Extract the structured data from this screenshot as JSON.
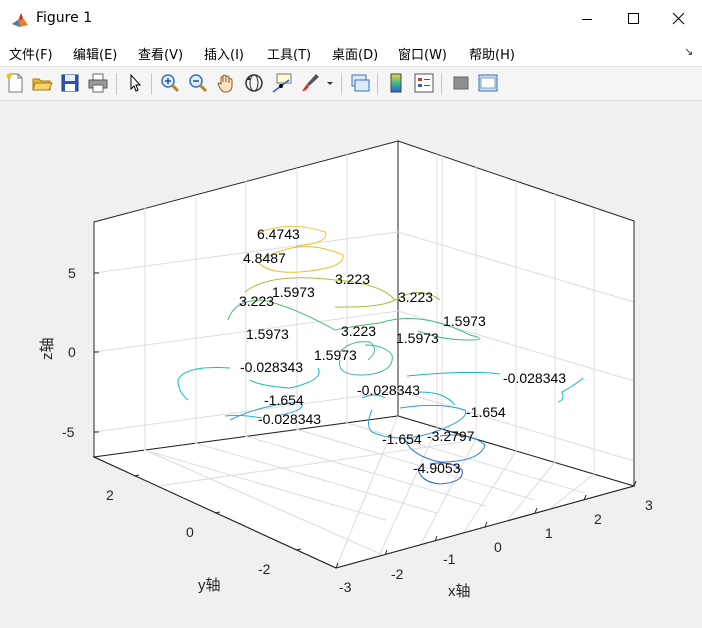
{
  "window": {
    "title": "Figure 1"
  },
  "menu": {
    "items": [
      "文件(F)",
      "编辑(E)",
      "查看(V)",
      "插入(I)",
      "工具(T)",
      "桌面(D)",
      "窗口(W)",
      "帮助(H)"
    ],
    "overflow": "↘"
  },
  "toolbar": {
    "icons": [
      "new-figure-icon",
      "open-file-icon",
      "save-icon",
      "print-icon",
      "pointer-icon",
      "zoom-in-icon",
      "zoom-out-icon",
      "pan-icon",
      "rotate-3d-icon",
      "data-cursor-icon",
      "brush-icon",
      "link-plot-icon",
      "colorbar-icon",
      "legend-icon",
      "hide-plot-tools-icon",
      "show-plot-tools-icon"
    ]
  },
  "axes": {
    "xlabel": "x轴",
    "ylabel": "y轴",
    "zlabel": "z轴",
    "xticks": [
      "-3",
      "-2",
      "-1",
      "0",
      "1",
      "2",
      "3"
    ],
    "yticks": [
      "2",
      "0",
      "-2"
    ],
    "zticks": [
      "5",
      "0",
      "-5"
    ]
  },
  "chart_data": {
    "type": "line",
    "subtype": "3d-contour",
    "title": "",
    "xlabel": "x轴",
    "ylabel": "y轴",
    "zlabel": "z轴",
    "xlim": [
      -3,
      3
    ],
    "ylim": [
      -3,
      3
    ],
    "zlim": [
      -6.5,
      8
    ],
    "grid": true,
    "contour_labels": [
      {
        "text": "6.4743",
        "x": -1.1,
        "y": 1.2,
        "z": 6.47
      },
      {
        "text": "4.8487",
        "x": -1.4,
        "y": 1.3,
        "z": 4.85
      },
      {
        "text": "3.223",
        "x": -0.2,
        "y": 1.6,
        "z": 3.22
      },
      {
        "text": "1.5973",
        "x": -1.0,
        "y": 1.5,
        "z": 1.6
      },
      {
        "text": "3.223",
        "x": 1.3,
        "y": 1.6,
        "z": 3.22
      },
      {
        "text": "3.223",
        "x": -1.8,
        "y": 1.2,
        "z": 3.22
      },
      {
        "text": "1.5973",
        "x": 1.9,
        "y": 1.5,
        "z": 1.6
      },
      {
        "text": "3.223",
        "x": -0.6,
        "y": 0.4,
        "z": 3.22
      },
      {
        "text": "1.5973",
        "x": -2.0,
        "y": 0.8,
        "z": 1.6
      },
      {
        "text": "1.5973",
        "x": 0.7,
        "y": 0.6,
        "z": 1.6
      },
      {
        "text": "1.5973",
        "x": -1.0,
        "y": 0.3,
        "z": 1.6
      },
      {
        "text": "-0.028343",
        "x": -1.6,
        "y": 0.3,
        "z": -0.03
      },
      {
        "text": "-0.028343",
        "x": 2.6,
        "y": 1.0,
        "z": -0.03
      },
      {
        "text": "-0.028343",
        "x": -0.2,
        "y": 0.2,
        "z": -0.03
      },
      {
        "text": "-1.654",
        "x": 1.2,
        "y": 0.0,
        "z": -1.65
      },
      {
        "text": "-1.654",
        "x": -2.2,
        "y": 0.2,
        "z": -1.65
      },
      {
        "text": "-0.028343",
        "x": -2.0,
        "y": -0.1,
        "z": -0.03
      },
      {
        "text": "-1.654",
        "x": -0.7,
        "y": -0.6,
        "z": -1.65
      },
      {
        "text": "-3.2797",
        "x": 0.0,
        "y": -0.6,
        "z": -3.28
      },
      {
        "text": "-4.9053",
        "x": 0.0,
        "y": -0.8,
        "z": -4.91
      }
    ]
  },
  "colors": {
    "level_high": "#f2c53d",
    "level_mid_high": "#a9bd3a",
    "level_mid": "#3fb98d",
    "level_low": "#19b8c0",
    "level_lower": "#2aa0d6",
    "level_lowest": "#2c5fd4"
  }
}
